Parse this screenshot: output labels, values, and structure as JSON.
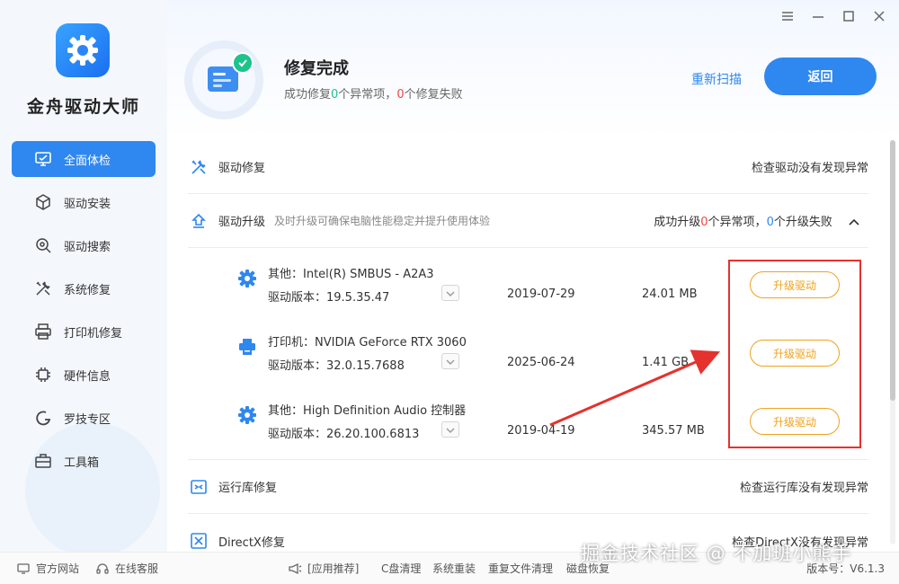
{
  "app": {
    "name": "金舟驱动大师",
    "accent": "#2f87f0",
    "success": "#1ec38c",
    "danger": "#f04545",
    "warning": "#f0a21c"
  },
  "window_controls": [
    "menu-icon",
    "minimize-icon",
    "maximize-icon",
    "close-icon"
  ],
  "sidebar": {
    "items": [
      {
        "label": "全面体检",
        "icon": "monitor-check-icon",
        "active": true
      },
      {
        "label": "驱动安装",
        "icon": "box-gear-icon"
      },
      {
        "label": "驱动搜索",
        "icon": "search-gear-icon"
      },
      {
        "label": "系统修复",
        "icon": "tools-icon"
      },
      {
        "label": "打印机修复",
        "icon": "printer-icon"
      },
      {
        "label": "硬件信息",
        "icon": "chip-icon"
      },
      {
        "label": "罗技专区",
        "icon": "logitech-icon"
      },
      {
        "label": "工具箱",
        "icon": "toolbox-icon"
      }
    ]
  },
  "header": {
    "title": "修复完成",
    "subtitle_prefix": "成功修复",
    "subtitle_fixed": "0",
    "subtitle_mid": "个异常项，",
    "subtitle_failed": "0",
    "subtitle_suffix": "个修复失败",
    "rescan_label": "重新扫描",
    "back_label": "返回"
  },
  "sections": {
    "repair": {
      "name": "驱动修复",
      "status": "检查驱动没有发现异常"
    },
    "upgrade": {
      "name": "驱动升级",
      "desc": "及时升级可确保电脑性能稳定并提升使用体验",
      "status_prefix": "成功升级",
      "status_ok": "0",
      "status_mid": "个异常项，",
      "status_fail": "0",
      "status_suffix": "个升级失败"
    },
    "runtime": {
      "name": "运行库修复",
      "status": "检查运行库没有发现异常"
    },
    "directx": {
      "name": "DirectX修复",
      "status": "检查DirectX没有发现异常"
    }
  },
  "drivers": [
    {
      "name": "其他：Intel(R) SMBUS - A2A3",
      "version": "驱动版本：19.5.35.47",
      "date": "2019-07-29",
      "size": "24.01 MB",
      "button": "升级驱动",
      "icon": "gear-icon"
    },
    {
      "name": "打印机：NVIDIA GeForce RTX 3060",
      "version": "驱动版本：32.0.15.7688",
      "date": "2025-06-24",
      "size": "1.41 GB",
      "button": "升级驱动",
      "icon": "printer-icon"
    },
    {
      "name": "其他：High Definition Audio 控制器",
      "version": "驱动版本：26.20.100.6813",
      "date": "2019-04-19",
      "size": "345.57 MB",
      "button": "升级驱动",
      "icon": "gear-icon"
    }
  ],
  "footer": {
    "official_site": "官方网站",
    "online_service": "在线客服",
    "app_recommend": "[应用推荐]",
    "links": [
      "C盘清理",
      "系统重装",
      "重复文件清理",
      "磁盘恢复"
    ],
    "version": "版本号：V6.1.3"
  },
  "watermark": "掘金技术社区 @ 不加班小熊手"
}
